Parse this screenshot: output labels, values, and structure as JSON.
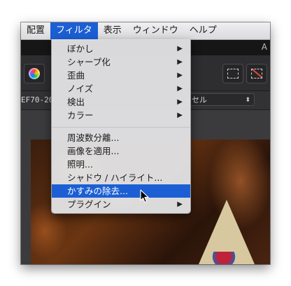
{
  "menubar": {
    "items": [
      {
        "label": "配置"
      },
      {
        "label": "フィルタ"
      },
      {
        "label": "表示"
      },
      {
        "label": "ウィンドウ"
      },
      {
        "label": "ヘルプ"
      }
    ]
  },
  "titlebar": {
    "letter": "A"
  },
  "context_bar": {
    "left_label": "EF70-20",
    "select_value": "ァセル",
    "select_arrows": "⬍"
  },
  "filter_menu": {
    "items": [
      {
        "label": "ぼかし",
        "submenu": "▶"
      },
      {
        "label": "シャープ化",
        "submenu": "▶"
      },
      {
        "label": "歪曲",
        "submenu": "▶"
      },
      {
        "label": "ノイズ",
        "submenu": "▶"
      },
      {
        "label": "検出",
        "submenu": "▶"
      },
      {
        "label": "カラー",
        "submenu": "▶"
      },
      {
        "label": "周波数分離..."
      },
      {
        "label": "画像を適用..."
      },
      {
        "label": "照明..."
      },
      {
        "label": "シャドウ / ハイライト..."
      },
      {
        "label": "かすみの除去..."
      },
      {
        "label": "プラグイン",
        "submenu": "▶"
      }
    ],
    "highlighted": "かすみの除去..."
  },
  "colors": {
    "accent": "#1c5fd4",
    "menu_bg": "#e0e0e2",
    "app_bg": "#2d2d2f"
  },
  "icons": [
    "color-wheel-icon",
    "marquee-select-icon",
    "no-selection-icon",
    "submenu-arrow-icon",
    "mouse-pointer-icon"
  ]
}
